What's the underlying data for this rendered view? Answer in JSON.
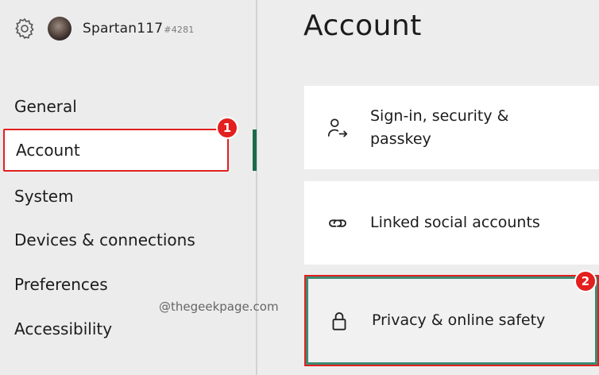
{
  "profile": {
    "gamertag": "Spartan117",
    "gamertag_suffix": "#4281"
  },
  "sidebar": {
    "items": [
      {
        "label": "General"
      },
      {
        "label": "Account"
      },
      {
        "label": "System"
      },
      {
        "label": "Devices & connections"
      },
      {
        "label": "Preferences"
      },
      {
        "label": "Accessibility"
      }
    ],
    "selected": "Account"
  },
  "main": {
    "title": "Account",
    "cards": [
      {
        "label": "Sign-in, security & passkey",
        "icon": "person-arrow-icon"
      },
      {
        "label": "Linked social accounts",
        "icon": "link-icon"
      },
      {
        "label": "Privacy & online safety",
        "icon": "lock-icon"
      }
    ]
  },
  "annotations": {
    "badge_1": "1",
    "badge_2": "2",
    "watermark": "@thegeekpage.com"
  },
  "colors": {
    "highlight_red": "#e02020",
    "accent_green": "#1b6b4a",
    "badge_red": "#e41f1f"
  }
}
